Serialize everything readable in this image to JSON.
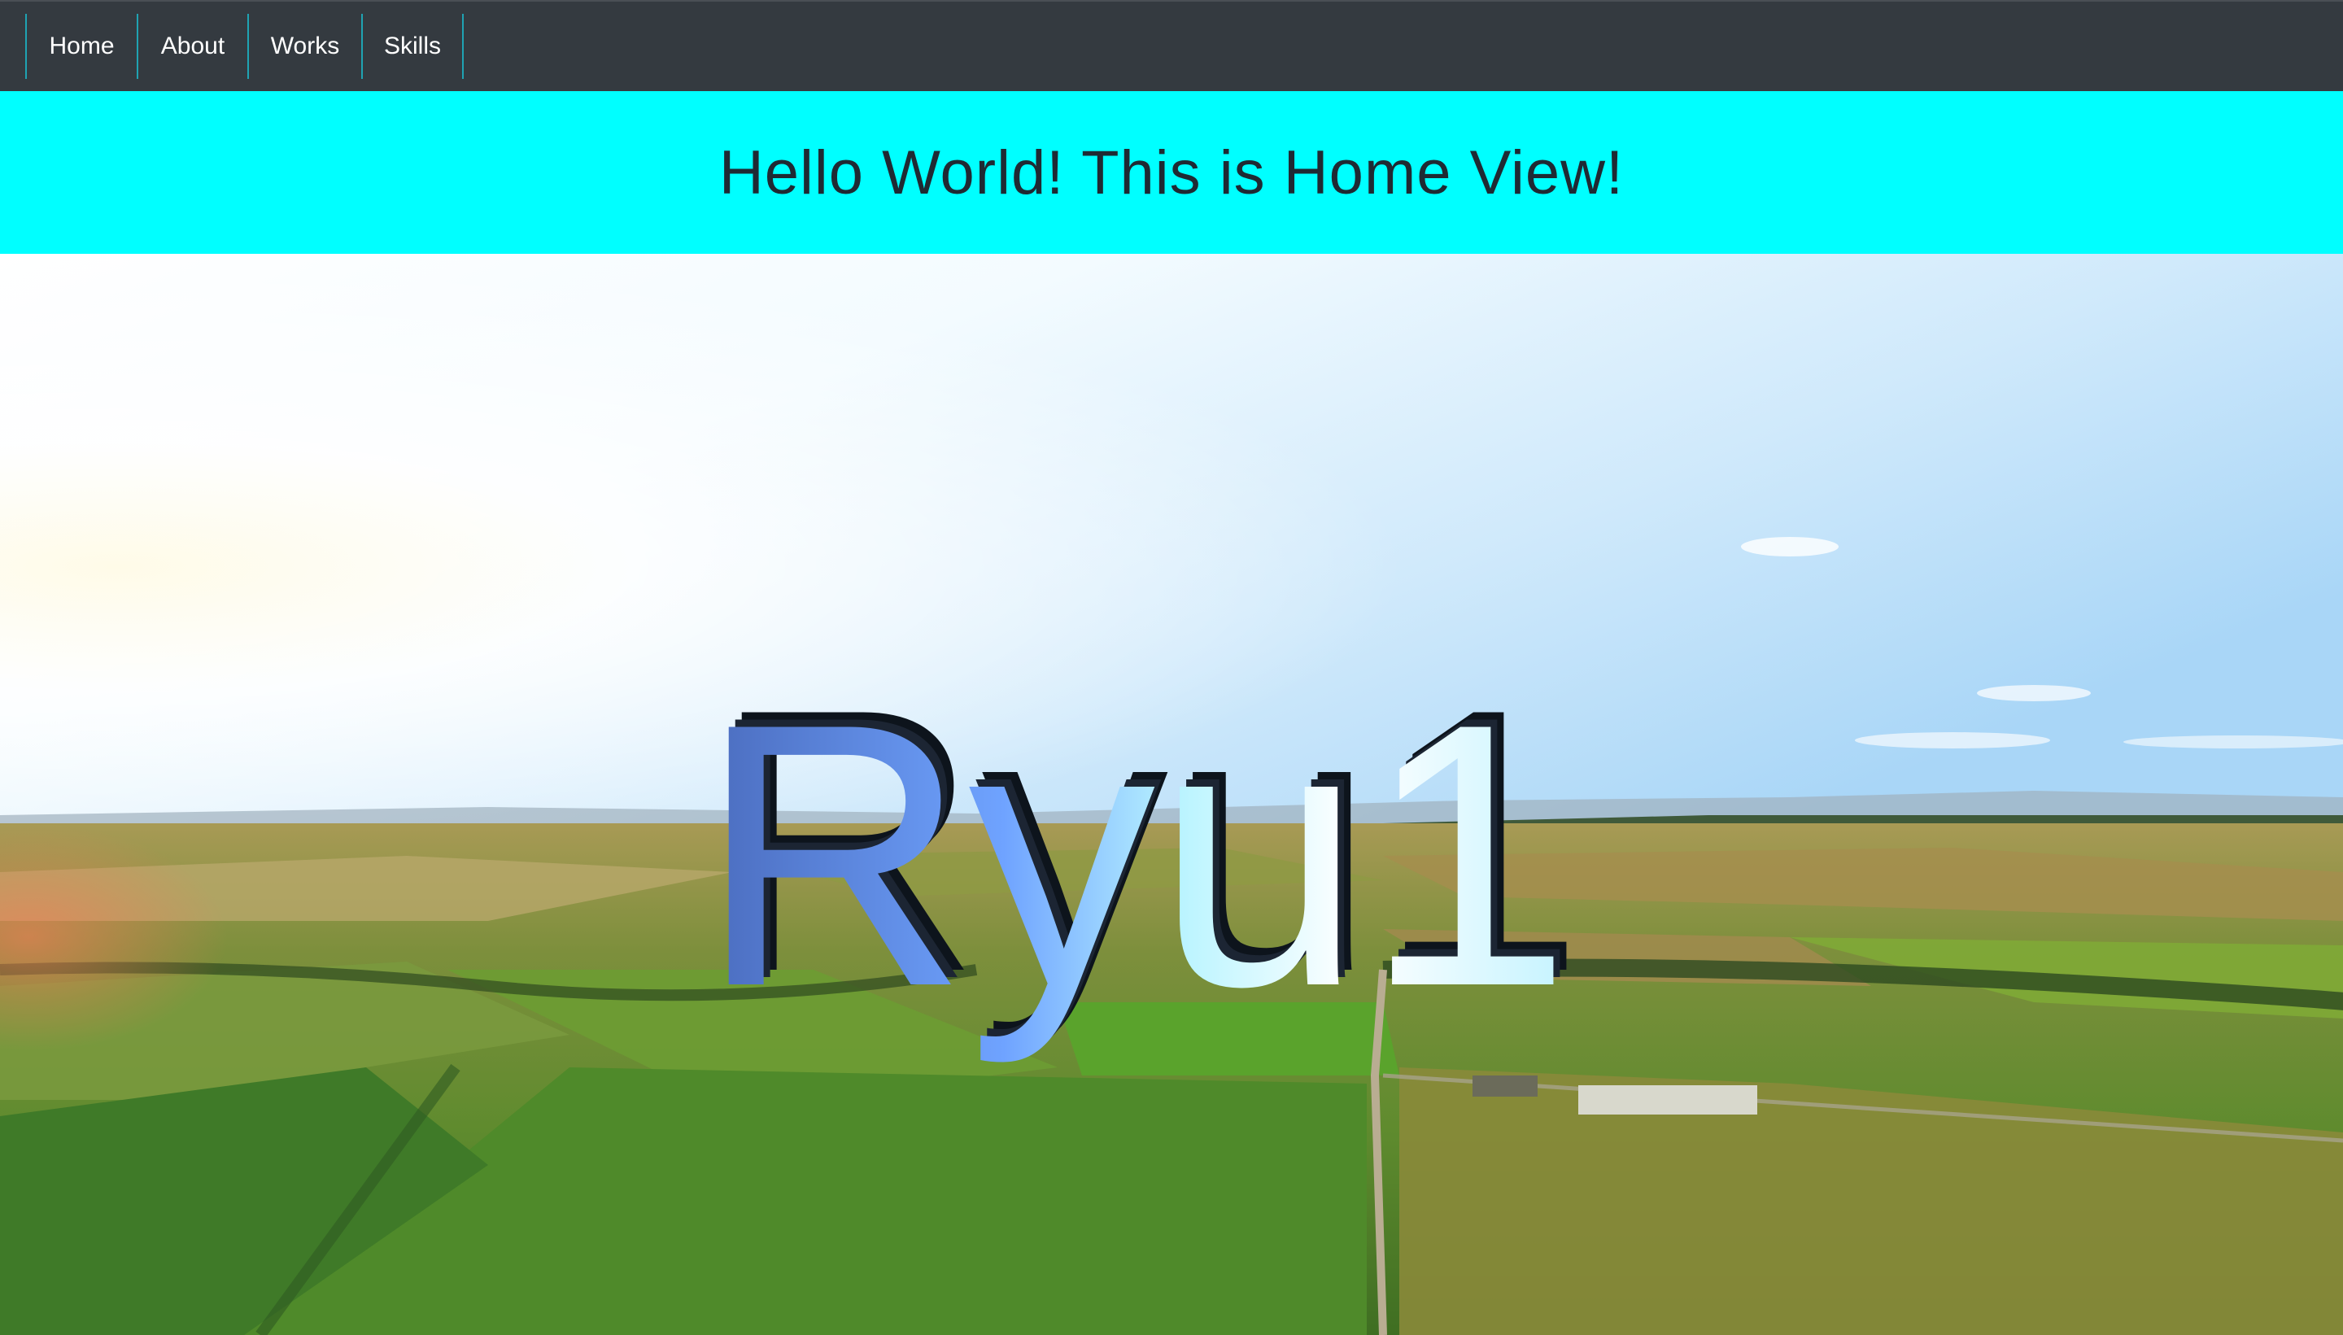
{
  "nav": {
    "items": [
      {
        "label": "Home"
      },
      {
        "label": "About"
      },
      {
        "label": "Works"
      },
      {
        "label": "Skills"
      }
    ],
    "background": "#343a40",
    "divider_color": "#1fa3b3"
  },
  "header": {
    "title": "Hello World! This is Home View!",
    "background": "#00ffff",
    "text_color": "#1f2a33"
  },
  "hero": {
    "text_3d": "Ryu1",
    "gradient_colors": [
      "#4a6bbd",
      "#6fa3ff",
      "#e8fbff",
      "#c4f3ff"
    ],
    "background_scene": "aerial-farmland-sunrise"
  }
}
